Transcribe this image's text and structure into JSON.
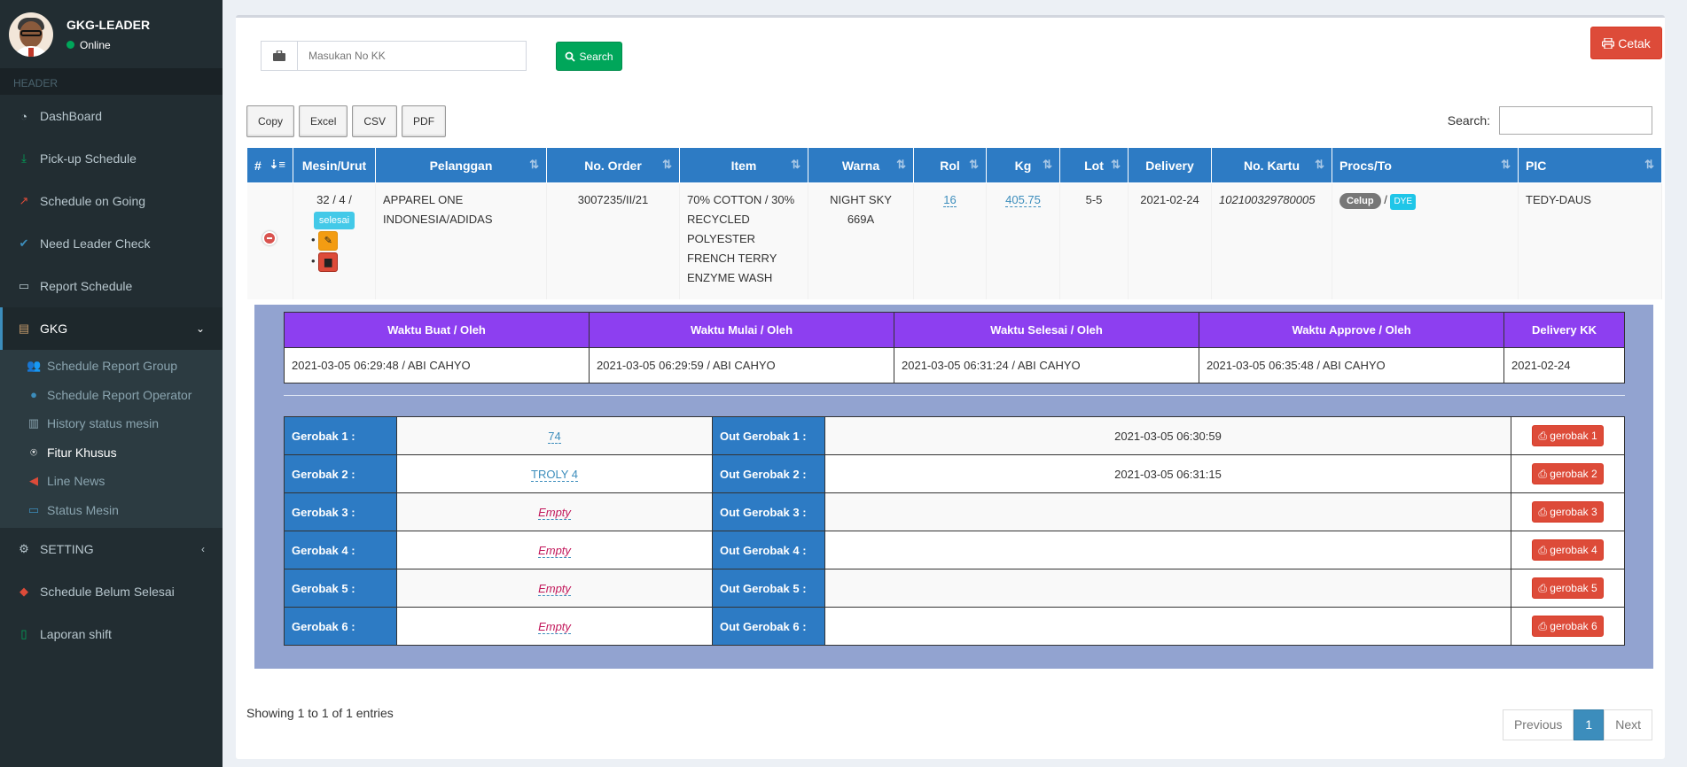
{
  "user": {
    "name": "GKG-LEADER",
    "status": "Online"
  },
  "sidebar": {
    "header": "HEADER",
    "items": [
      {
        "label": "DashBoard",
        "icon": "dashboard-icon"
      },
      {
        "label": "Pick-up Schedule",
        "icon": "download-icon"
      },
      {
        "label": "Schedule on Going",
        "icon": "line-chart-icon"
      },
      {
        "label": "Need Leader Check",
        "icon": "check-icon"
      },
      {
        "label": "Report Schedule",
        "icon": "laptop-icon"
      },
      {
        "label": "GKG",
        "icon": "archive-icon"
      },
      {
        "label": "SETTING",
        "icon": "gear-icon"
      },
      {
        "label": "Schedule Belum Selesai",
        "icon": "tags-icon"
      },
      {
        "label": "Laporan shift",
        "icon": "file-icon"
      }
    ],
    "submenu": [
      {
        "label": "Schedule Report Group",
        "icon": "users-icon"
      },
      {
        "label": "Schedule Report Operator",
        "icon": "user-icon"
      },
      {
        "label": "History status mesin",
        "icon": "bar-chart-icon"
      },
      {
        "label": "Fitur Khusus",
        "icon": "special-icon"
      },
      {
        "label": "Line News",
        "icon": "megaphone-icon"
      },
      {
        "label": "Status Mesin",
        "icon": "monitor-icon"
      }
    ]
  },
  "toolbar": {
    "kk_placeholder": "Masukan No KK",
    "search_label": "Search",
    "cetak_label": "Cetak",
    "copy": "Copy",
    "excel": "Excel",
    "csv": "CSV",
    "pdf": "PDF",
    "search_text": "Search:"
  },
  "table": {
    "headers": [
      "#",
      "Mesin/Urut",
      "Pelanggan",
      "No. Order",
      "Item",
      "Warna",
      "Rol",
      "Kg",
      "Lot",
      "Delivery",
      "No. Kartu",
      "Procs/To",
      "PIC"
    ],
    "row": {
      "mesin": "32 / 4 /",
      "status": "selesai",
      "pelanggan": "APPAREL ONE INDONESIA/ADIDAS",
      "order": "3007235/II/21",
      "item": "70% COTTON / 30% RECYCLED POLYESTER FRENCH TERRY ENZYME WASH",
      "warna": "NIGHT SKY 669A",
      "rol": "16",
      "kg": "405.75",
      "lot": "5-5",
      "delivery": "2021-02-24",
      "kartu": "102100329780005",
      "proc": "Celup",
      "sep": "/",
      "to": "DYE",
      "pic": "TEDY-DAUS"
    }
  },
  "detail": {
    "time_headers": [
      "Waktu Buat / Oleh",
      "Waktu Mulai / Oleh",
      "Waktu Selesai / Oleh",
      "Waktu Approve / Oleh",
      "Delivery KK"
    ],
    "time_values": [
      "2021-03-05 06:29:48 / ABI CAHYO",
      "2021-03-05 06:29:59 / ABI CAHYO",
      "2021-03-05 06:31:24 / ABI CAHYO",
      "2021-03-05 06:35:48 / ABI CAHYO",
      "2021-02-24"
    ],
    "gerobak": [
      {
        "label": "Gerobak 1 :",
        "value": "74",
        "out_label": "Out Gerobak 1 :",
        "out": "2021-03-05 06:30:59",
        "btn": "gerobak 1"
      },
      {
        "label": "Gerobak 2 :",
        "value": "TROLY 4",
        "out_label": "Out Gerobak 2 :",
        "out": "2021-03-05 06:31:15",
        "btn": "gerobak 2"
      },
      {
        "label": "Gerobak 3 :",
        "value": "Empty",
        "out_label": "Out Gerobak 3 :",
        "out": "",
        "btn": "gerobak 3"
      },
      {
        "label": "Gerobak 4 :",
        "value": "Empty",
        "out_label": "Out Gerobak 4 :",
        "out": "",
        "btn": "gerobak 4"
      },
      {
        "label": "Gerobak 5 :",
        "value": "Empty",
        "out_label": "Out Gerobak 5 :",
        "out": "",
        "btn": "gerobak 5"
      },
      {
        "label": "Gerobak 6 :",
        "value": "Empty",
        "out_label": "Out Gerobak 6 :",
        "out": "",
        "btn": "gerobak 6"
      }
    ]
  },
  "footer": {
    "info": "Showing 1 to 1 of 1 entries",
    "previous": "Previous",
    "page": "1",
    "next": "Next"
  }
}
